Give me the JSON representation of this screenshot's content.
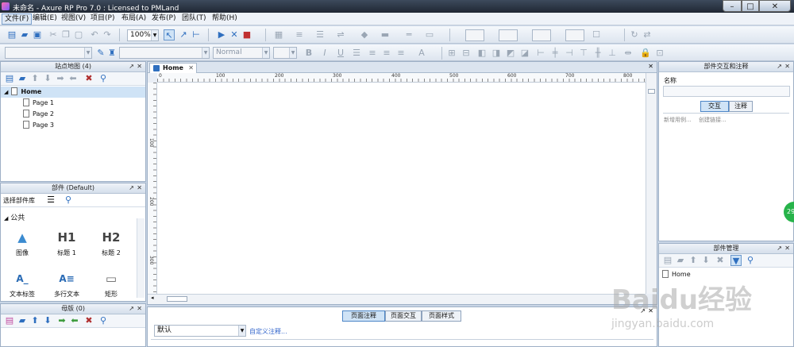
{
  "window": {
    "title": "未命名 - Axure RP Pro 7.0 : Licensed to PMLand"
  },
  "menu": [
    "文件(F)",
    "编辑(E)",
    "视图(V)",
    "项目(P)",
    "布局(A)",
    "发布(P)",
    "团队(T)",
    "帮助(H)"
  ],
  "toolbar": {
    "zoom": "100%",
    "font_style": "Normal"
  },
  "sitemap": {
    "title": "站点地图 (4)",
    "pages": [
      "Home",
      "Page 1",
      "Page 2",
      "Page 3"
    ]
  },
  "widgets": {
    "title": "部件 (Default)",
    "library_label": "选择部件库",
    "group": "公共",
    "items": [
      {
        "glyph": "▲",
        "label": "图像"
      },
      {
        "glyph": "H1",
        "label": "标题 1"
      },
      {
        "glyph": "H2",
        "label": "标题 2"
      },
      {
        "glyph": "A_",
        "label": "文本标签"
      },
      {
        "glyph": "A≡",
        "label": "多行文本"
      },
      {
        "glyph": "▭",
        "label": "矩形"
      }
    ]
  },
  "masters": {
    "title": "母版 (0)"
  },
  "canvas": {
    "tab_label": "Home",
    "h_ruler": [
      "0",
      "100",
      "200",
      "300",
      "400",
      "500",
      "600",
      "700",
      "800"
    ],
    "v_ruler": [
      "100",
      "200",
      "300"
    ]
  },
  "notes": {
    "tabs": [
      "页面注释",
      "页面交互",
      "页面样式"
    ],
    "active_tab": 0,
    "select_value": "默认",
    "custom_link": "自定义注释..."
  },
  "interactions": {
    "title": "部件交互和注释",
    "name_label": "名称",
    "tabs": [
      "交互",
      "注释"
    ],
    "new_case": "新增用例...",
    "create_link": "创建链接..."
  },
  "widget_manager": {
    "title": "部件管理",
    "item": "Home"
  },
  "badge": "29",
  "watermark": {
    "main": "Baidu经验",
    "sub": "jingyan.baidu.com"
  }
}
